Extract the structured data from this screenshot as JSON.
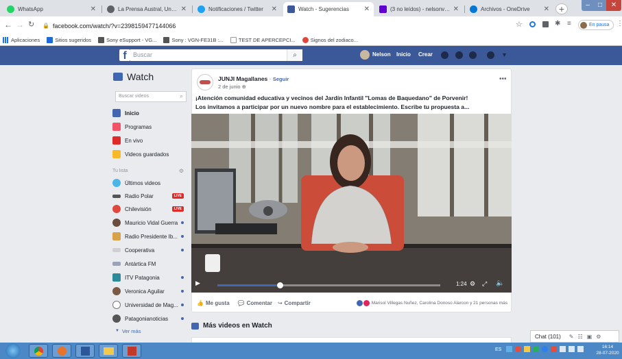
{
  "browser": {
    "tabs": [
      {
        "label": "WhatsApp",
        "color": "#25d366"
      },
      {
        "label": "La Prensa Austral, Un diario con",
        "color": "#5f6368"
      },
      {
        "label": "Notificaciones / Twitter",
        "color": "#1da1f2"
      },
      {
        "label": "Watch - Sugerencias",
        "color": "#3b5998"
      },
      {
        "label": "(3 no leídos) - nelsonvidal@yah",
        "color": "#6001d2"
      },
      {
        "label": "Archivos - OneDrive",
        "color": "#0078d4"
      }
    ],
    "url": "facebook.com/watch/?v=2398159477144066",
    "profile_status": "En pausa",
    "bookmarks": [
      "Aplicaciones",
      "Sitios sugeridos",
      "Sony eSupport - VG...",
      "Sony : VGN-FE31B :...",
      "TEST DE APERCEPCI...",
      "Signos del zodiaco..."
    ]
  },
  "fb": {
    "logo": "f",
    "search_placeholder": "Buscar",
    "user": "Nelson",
    "nav_home": "Inicio",
    "nav_create": "Crear"
  },
  "sidebar": {
    "title": "Watch",
    "search_placeholder": "Buscar videos",
    "main_items": [
      {
        "label": "Inicio",
        "color": "#4267b2"
      },
      {
        "label": "Programas",
        "color": "#f35369"
      },
      {
        "label": "En vivo",
        "color": "#e02a2a"
      },
      {
        "label": "Videos guardados",
        "color": "#f7b928"
      }
    ],
    "list_header": "Tu lista",
    "list_items": [
      {
        "label": "Últimos videos",
        "color": "#4bb5e8",
        "badge": ""
      },
      {
        "label": "Radio Polar",
        "color": "#555555",
        "badge": "LIVE"
      },
      {
        "label": "Chilevisión",
        "color": "#e0483e",
        "badge": "LIVE"
      },
      {
        "label": "Mauricio Vidal Guerra",
        "color": "#6a4e3d",
        "badge": "dot"
      },
      {
        "label": "Radio Presidente Ib...",
        "color": "#d8a24b",
        "badge": "dot"
      },
      {
        "label": "Cooperativa",
        "color": "#c9c9c9",
        "badge": "dot"
      },
      {
        "label": "Antártica FM",
        "color": "#88a",
        "badge": ""
      },
      {
        "label": "ITV Patagonia",
        "color": "#2d8a9a",
        "badge": "dot"
      },
      {
        "label": "Veronica Aguilar",
        "color": "#7a5a45",
        "badge": "dot"
      },
      {
        "label": "Universidad de Mag...",
        "color": "#ffffff",
        "badge": "dot"
      },
      {
        "label": "Patagonianoticias",
        "color": "#555555",
        "badge": "dot"
      }
    ],
    "see_more": "Ver más"
  },
  "post": {
    "author": "JUNJI Magallanes",
    "follow": "Seguir",
    "date": "2 de junio",
    "text_line1": "¡Atención comunidad educativa y vecinos del Jardín Infantil \"Lomas de Baquedano\" de Porvenir!",
    "text_line2": "Los invitamos a participar por un nuevo nombre para el establecimiento. Escribe tu propuesta a...",
    "video_time": "1:24",
    "progress": 0.28,
    "like": "Me gusta",
    "comment": "Comentar",
    "share": "Compartir",
    "reactions": "Marisol Villegas Nuñez, Carolina Donoso Alarcon y 21 personas más"
  },
  "more_videos": "Más videos en Watch",
  "chat": "Chat (101)",
  "clock": {
    "time": "16:14",
    "date": "28-07-2020"
  },
  "taskbar_lang": "ES"
}
